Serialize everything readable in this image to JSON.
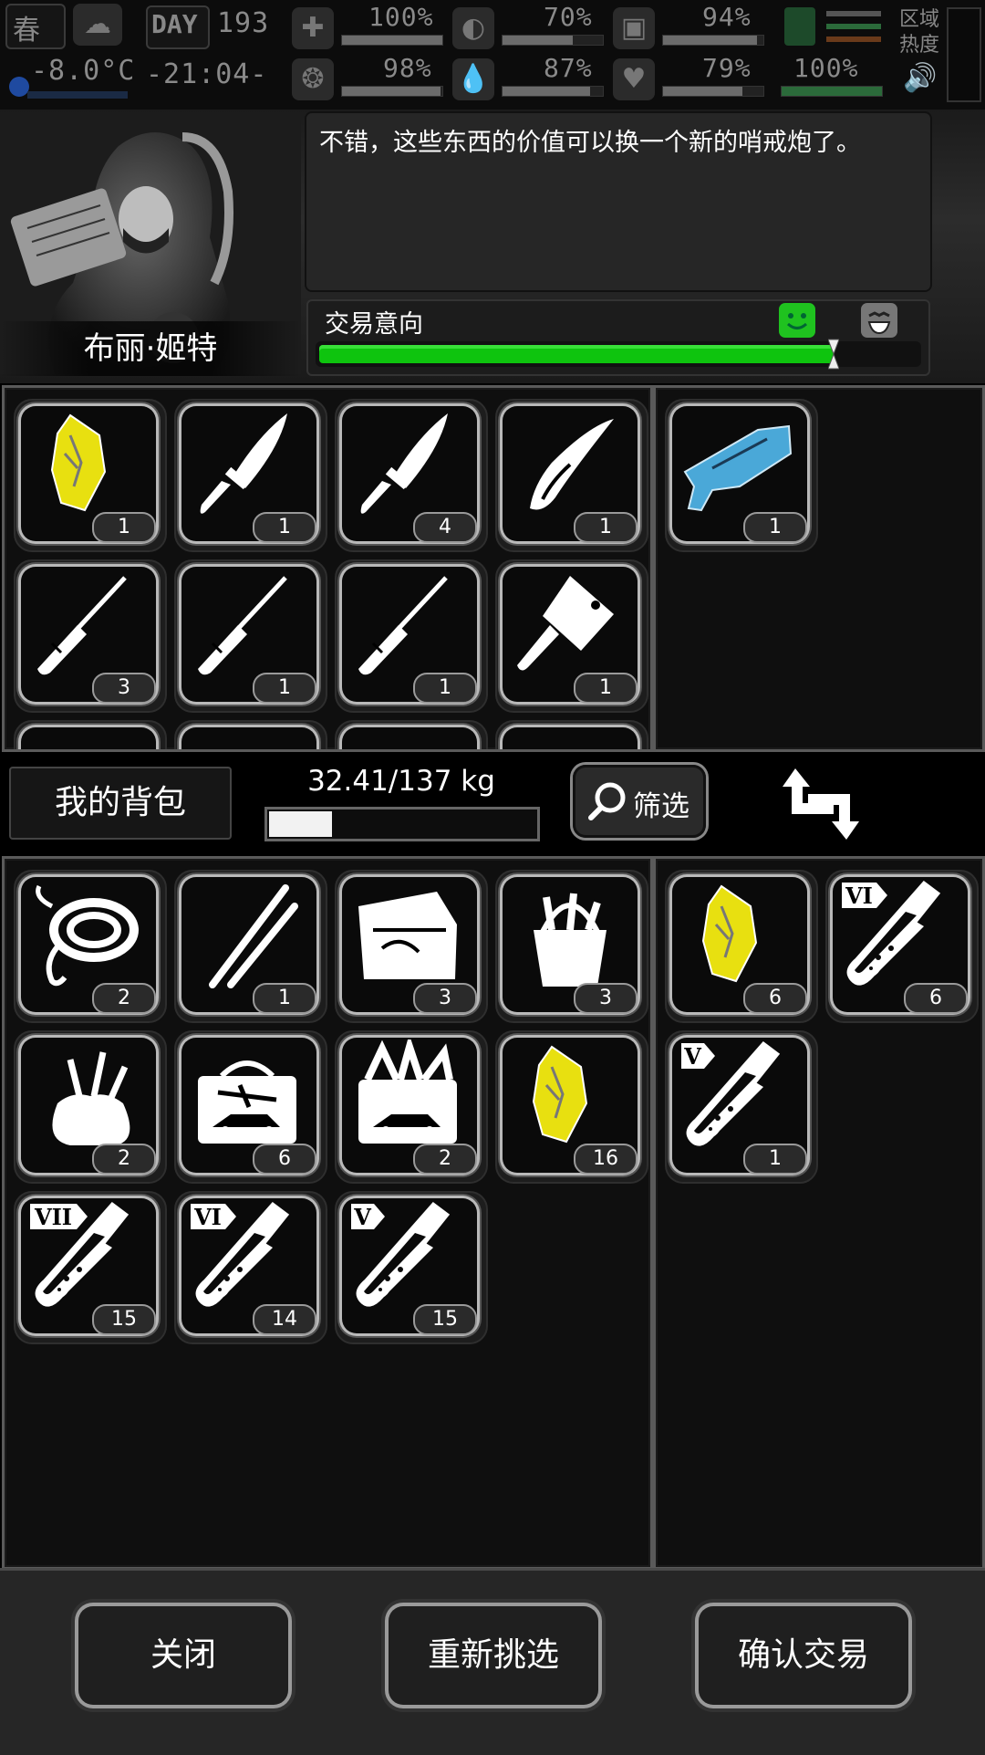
{
  "status": {
    "season": "春",
    "temperature": "-8.0°C",
    "day_label": "DAY",
    "day_number": "193",
    "time": "-21:04-",
    "stats": [
      {
        "name": "health",
        "value": "100%",
        "level": 1.0
      },
      {
        "name": "brain",
        "value": "98%",
        "level": 0.98
      },
      {
        "name": "stomach",
        "value": "70%",
        "level": 0.7
      },
      {
        "name": "water",
        "value": "87%",
        "level": 0.87
      },
      {
        "name": "stamina",
        "value": "94%",
        "level": 0.94
      },
      {
        "name": "mood",
        "value": "79%",
        "level": 0.79
      },
      {
        "name": "leg",
        "value": "100%",
        "level": 1.0
      }
    ],
    "zone_heat": "区域\n热度"
  },
  "npc": {
    "name": "布丽·姬特",
    "dialog": "不错，这些东西的价值可以换一个新的哨戒炮了。",
    "intent_label": "交易意向",
    "intent_level": 0.86
  },
  "trader_items": [
    {
      "icon": "gold-nugget-icon",
      "count": "1"
    },
    {
      "icon": "combat-knife-icon",
      "count": "1"
    },
    {
      "icon": "combat-knife-icon",
      "count": "4"
    },
    {
      "icon": "folding-knife-icon",
      "count": "1"
    },
    {
      "icon": "screwdriver-icon",
      "count": "3"
    },
    {
      "icon": "screwdriver-icon",
      "count": "1"
    },
    {
      "icon": "screwdriver-icon",
      "count": "1"
    },
    {
      "icon": "cleaver-icon",
      "count": "1"
    }
  ],
  "trader_offer": [
    {
      "icon": "sentry-gun-icon",
      "count": "1"
    }
  ],
  "bag": {
    "title": "我的背包",
    "weight": "32.41/137 kg",
    "weight_level": 0.2366,
    "filter_label": "筛选"
  },
  "bag_items": [
    {
      "icon": "rope-icon",
      "count": "2"
    },
    {
      "icon": "tweezers-icon",
      "count": "1"
    },
    {
      "icon": "toolbox-open-icon",
      "count": "3"
    },
    {
      "icon": "tool-bucket-icon",
      "count": "3"
    },
    {
      "icon": "tool-sack-icon",
      "count": "2"
    },
    {
      "icon": "car-toolbox-icon",
      "count": "6"
    },
    {
      "icon": "car-toolbox-full-icon",
      "count": "2"
    },
    {
      "icon": "gold-nugget-icon",
      "count": "16"
    },
    {
      "icon": "test-tube-icon",
      "tier": "VII",
      "count": "15"
    },
    {
      "icon": "test-tube-icon",
      "tier": "VI",
      "count": "14"
    },
    {
      "icon": "test-tube-icon",
      "tier": "V",
      "count": "15"
    }
  ],
  "bag_offer": [
    {
      "icon": "gold-nugget-icon",
      "count": "6"
    },
    {
      "icon": "test-tube-icon",
      "tier": "VI",
      "count": "6"
    },
    {
      "icon": "test-tube-icon",
      "tier": "V",
      "count": "1"
    }
  ],
  "buttons": {
    "close": "关闭",
    "reselect": "重新挑选",
    "confirm": "确认交易"
  },
  "colors": {
    "intent_green": "#0ec40e",
    "sentry_blue": "#4aa8d8",
    "gold": "#e8e010"
  }
}
